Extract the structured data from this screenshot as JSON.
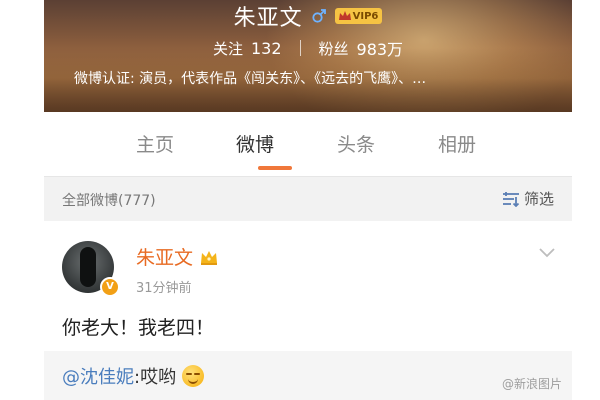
{
  "profile": {
    "name": "朱亚文",
    "vip_label": "VIP6",
    "following_label": "关注",
    "following_count": "132",
    "followers_label": "粉丝",
    "followers_count": "983万",
    "verification": "微博认证: 演员，代表作品《闯关东》、《远去的飞鹰》、…"
  },
  "tabs": [
    {
      "label": "主页",
      "active": false
    },
    {
      "label": "微博",
      "active": true
    },
    {
      "label": "头条",
      "active": false
    },
    {
      "label": "相册",
      "active": false
    }
  ],
  "filter_bar": {
    "all_label": "全部微博(777)",
    "filter_label": "筛选"
  },
  "post": {
    "author": "朱亚文",
    "time": "31分钟前",
    "text": "你老大！我老四！",
    "reply_mention": "@沈佳妮",
    "reply_text": ":哎哟"
  },
  "watermark": "@新浪图片",
  "colors": {
    "accent": "#f0773a",
    "author_name": "#e86b23",
    "mention": "#4a7dbd"
  },
  "icons": {
    "gender": "male-icon",
    "vip": "crown-icon",
    "filter": "filter-icon",
    "post_menu": "chevron-down-icon",
    "emoji": "smile-emoji-icon"
  }
}
